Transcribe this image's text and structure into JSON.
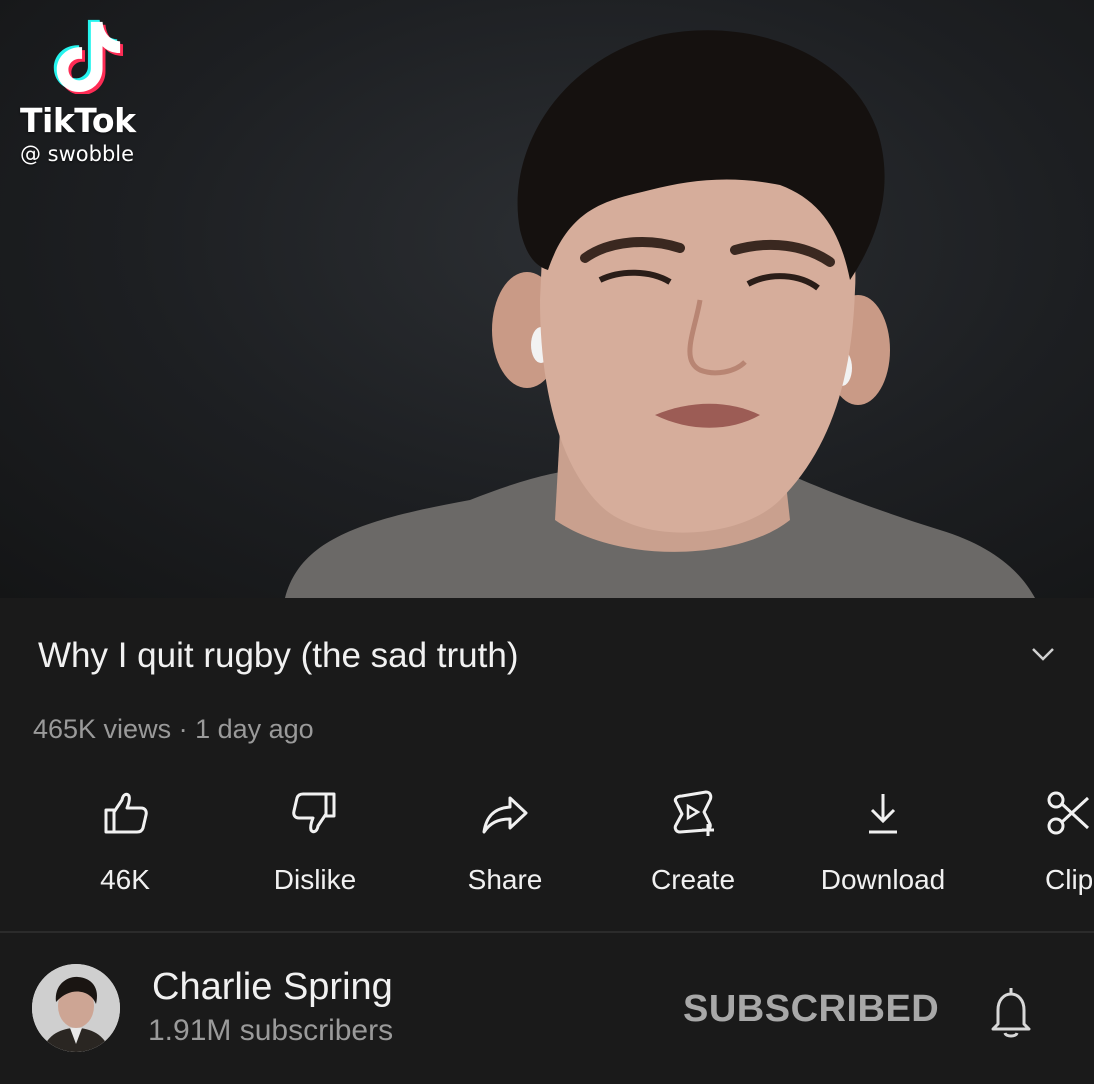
{
  "overlay": {
    "brand": "TikTok",
    "handle": "@ swobble"
  },
  "video": {
    "title": "Why I quit rugby (the sad truth)",
    "meta": "465K views · 1 day ago"
  },
  "actions": [
    {
      "label": "46K",
      "icon": "thumbs-up-icon"
    },
    {
      "label": "Dislike",
      "icon": "thumbs-down-icon"
    },
    {
      "label": "Share",
      "icon": "share-icon"
    },
    {
      "label": "Create",
      "icon": "create-icon"
    },
    {
      "label": "Download",
      "icon": "download-icon"
    },
    {
      "label": "Clip",
      "icon": "scissors-icon"
    }
  ],
  "channel": {
    "name": "Charlie Spring",
    "subscribers": "1.91M subscribers",
    "subscribe_label": "SUBSCRIBED",
    "bell_icon": "bell-icon"
  },
  "colors": {
    "panel_bg": "#1a1a1a",
    "text_primary": "#f1f1f1",
    "text_secondary": "#9a9a9a",
    "tiktok_cyan": "#25f4ee",
    "tiktok_red": "#fe2c55"
  }
}
